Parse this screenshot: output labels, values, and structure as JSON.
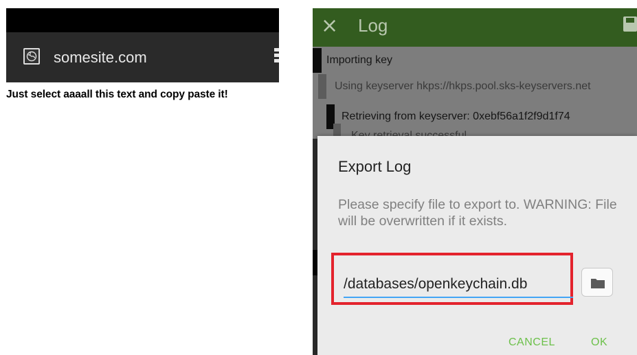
{
  "browser": {
    "url": "somesite.com",
    "body_text": "Just select aaaall this text and copy paste it!",
    "site_icon": "globe-icon",
    "menu_icon": "overflow-menu-icon"
  },
  "app": {
    "toolbar": {
      "title": "Log",
      "close_icon": "×",
      "save_icon": "save-icon",
      "color": "#335c1f"
    },
    "log_entries": [
      {
        "text": "Importing key"
      },
      {
        "text": "Using keyserver hkps://hkps.pool.sks-keyservers.net"
      },
      {
        "text": "Retrieving from keyserver: 0xebf56a1f2f9d1f74"
      },
      {
        "text": "Key retrieval successful"
      }
    ],
    "dialog": {
      "title": "Export Log",
      "message": "Please specify file to export to. WARNING: File will be overwritten if it exists.",
      "path_value": "/databases/openkeychain.db",
      "folder_icon": "folder-icon",
      "cancel_label": "CANCEL",
      "ok_label": "OK",
      "accent_color": "#6cc04a",
      "highlight_color": "#e3232d"
    }
  }
}
